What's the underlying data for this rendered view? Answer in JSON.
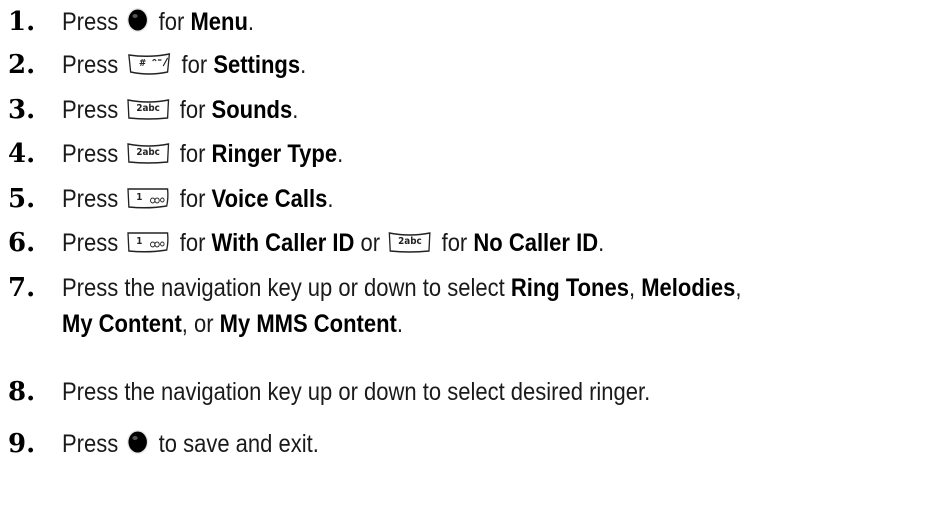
{
  "steps": [
    {
      "num": "1.",
      "pre": "Press",
      "key": "nav-select",
      "mid": "for",
      "bold1": "Menu",
      "end": "."
    },
    {
      "num": "2.",
      "pre": "Press",
      "key": "hash",
      "key_label": "#",
      "mid": "for",
      "bold1": "Settings",
      "end": "."
    },
    {
      "num": "3.",
      "pre": "Press",
      "key": "2abc",
      "key_label": "2abc",
      "mid": "for",
      "bold1": "Sounds",
      "end": "."
    },
    {
      "num": "4.",
      "pre": "Press",
      "key": "2abc",
      "key_label": "2abc",
      "mid": "for",
      "bold1": "Ringer Type",
      "end": "."
    },
    {
      "num": "5.",
      "pre": "Press",
      "key": "1",
      "key_label": "1",
      "mid": "for",
      "bold1": "Voice Calls",
      "end": "."
    },
    {
      "num": "6.",
      "pre": "Press",
      "key": "1",
      "key_label": "1",
      "mid": "for",
      "bold1": "With Caller ID",
      "or": "or",
      "key2": "2abc",
      "key2_label": "2abc",
      "mid2": "for",
      "bold2": "No Caller ID",
      "end": "."
    },
    {
      "num": "7.",
      "line1_pre": "Press the navigation key up or down to select",
      "bold1": "Ring Tones",
      "sep1": ",",
      "bold2": "Melodies",
      "sep2": ",",
      "bold3": "My Content",
      "sep3": ", or",
      "bold4": "My MMS Content",
      "end": "."
    },
    {
      "num": "8.",
      "text": "Press the navigation key up or down to select desired ringer."
    },
    {
      "num": "9.",
      "pre": "Press",
      "key": "nav-select",
      "post": "to save and exit."
    }
  ]
}
